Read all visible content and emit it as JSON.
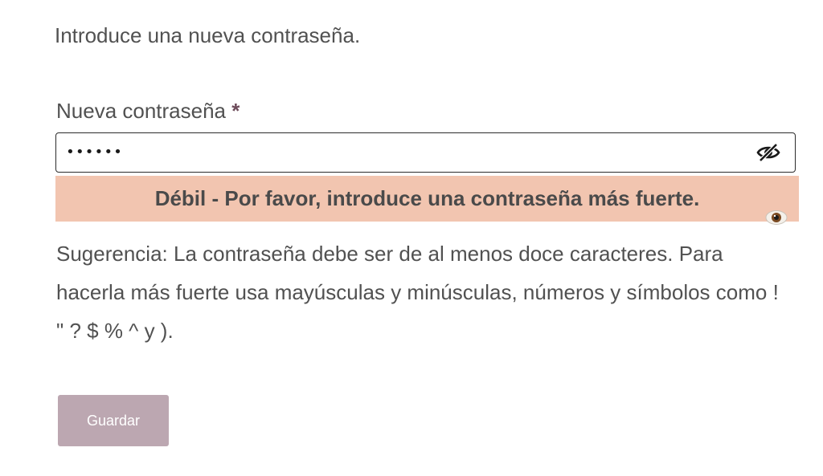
{
  "form": {
    "intro": "Introduce una nueva contraseña.",
    "password_label": "Nueva contraseña",
    "required_marker": "*",
    "password_value": "••••••",
    "toggle_icon": "eye-slash-icon",
    "strength_message": "Débil - Por favor, introduce una contraseña más fuerte.",
    "strength_color": "#f2c5b0",
    "hint": "Sugerencia: La contraseña debe ser de al menos doce caracteres. Para hacerla más fuerte usa mayúsculas y minúsculas, números y símbolos como ! \" ? $ % ^ y ).",
    "save_label": "Guardar",
    "save_color": "#bca7b1"
  }
}
